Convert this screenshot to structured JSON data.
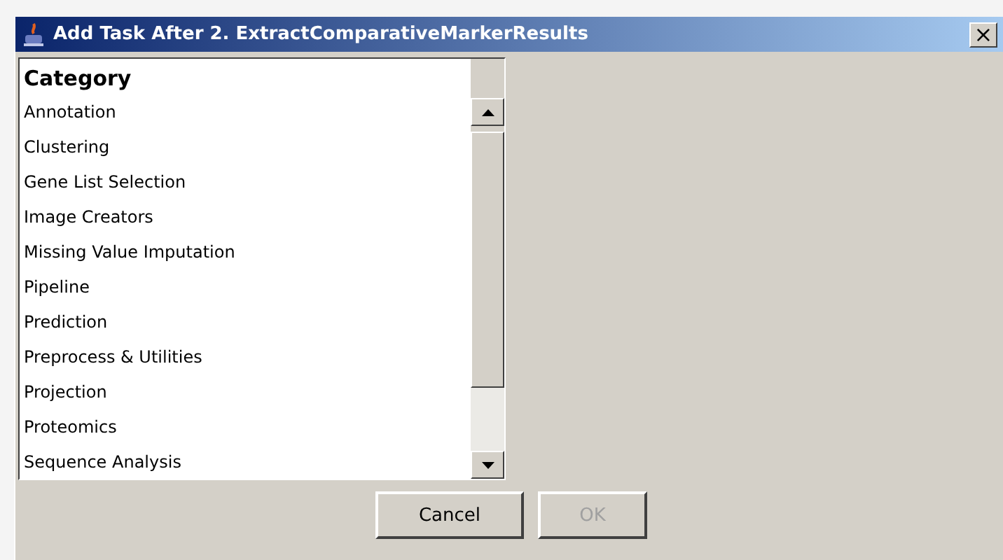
{
  "window": {
    "title": "Add Task After 2. ExtractComparativeMarkerResults",
    "close": "×"
  },
  "list": {
    "header": "Category",
    "items": [
      {
        "label": "Annotation",
        "selected": false
      },
      {
        "label": "Clustering",
        "selected": false
      },
      {
        "label": "Gene List Selection",
        "selected": false
      },
      {
        "label": "Image Creators",
        "selected": false
      },
      {
        "label": "Missing Value Imputation",
        "selected": false
      },
      {
        "label": "Pipeline",
        "selected": false
      },
      {
        "label": "Prediction",
        "selected": false
      },
      {
        "label": "Preprocess & Utilities",
        "selected": false
      },
      {
        "label": "Projection",
        "selected": false
      },
      {
        "label": "Proteomics",
        "selected": false
      },
      {
        "label": "Sequence Analysis",
        "selected": false
      }
    ]
  },
  "buttons": [
    {
      "label": "Cancel",
      "disabled": false
    },
    {
      "label": "OK",
      "disabled": true
    }
  ]
}
